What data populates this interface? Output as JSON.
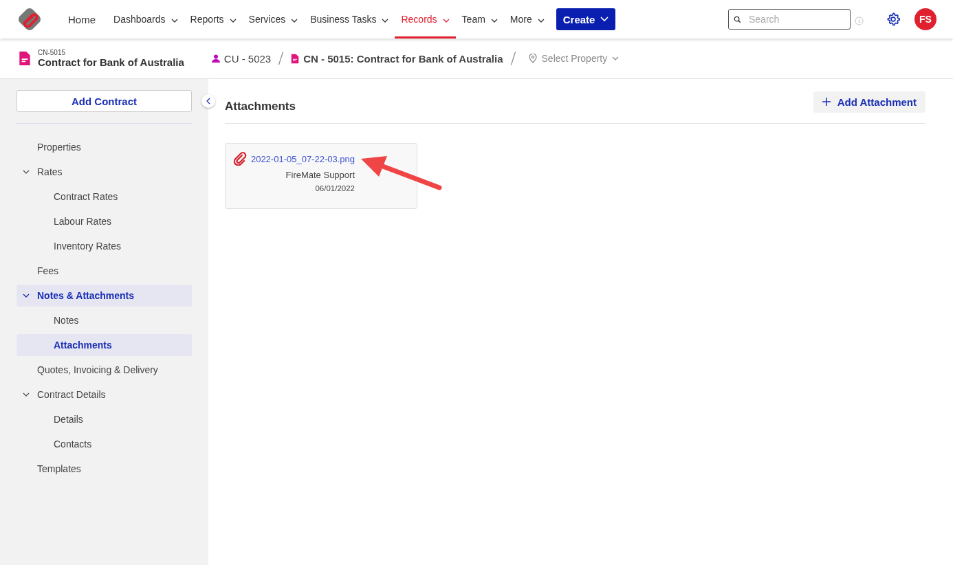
{
  "nav": {
    "items": [
      {
        "label": "Home",
        "dropdown": false,
        "selected": false
      },
      {
        "label": "Dashboards",
        "dropdown": true,
        "selected": false
      },
      {
        "label": "Reports",
        "dropdown": true,
        "selected": false
      },
      {
        "label": "Services",
        "dropdown": true,
        "selected": false
      },
      {
        "label": "Business Tasks",
        "dropdown": true,
        "selected": false
      },
      {
        "label": "Records",
        "dropdown": true,
        "selected": true
      },
      {
        "label": "Team",
        "dropdown": true,
        "selected": false
      },
      {
        "label": "More",
        "dropdown": true,
        "selected": false
      }
    ],
    "create_button": "Create",
    "search": {
      "placeholder": "Search"
    },
    "avatar": "FS"
  },
  "record": {
    "code": "CN-5015",
    "title": "Contract for Bank of Australia"
  },
  "breadcrumb": {
    "customer": "CU - 5023",
    "contract": "CN - 5015: Contract for Bank of Australia",
    "property": {
      "placeholder": "Select Property"
    }
  },
  "sidebar": {
    "button": "Add Contract",
    "items": [
      {
        "label": "Properties",
        "selected": false
      },
      {
        "label": "Rates",
        "selected": false,
        "expanded": true,
        "children": [
          {
            "label": "Contract Rates",
            "selected": false
          },
          {
            "label": "Labour Rates",
            "selected": false
          },
          {
            "label": "Inventory Rates",
            "selected": false
          }
        ]
      },
      {
        "label": "Fees",
        "selected": false
      },
      {
        "label": "Notes & Attachments",
        "selected": true,
        "expanded": true,
        "children": [
          {
            "label": "Notes",
            "selected": false
          },
          {
            "label": "Attachments",
            "selected": true
          }
        ]
      },
      {
        "label": "Quotes, Invoicing & Delivery",
        "selected": false
      },
      {
        "label": "Contract Details",
        "selected": false,
        "expanded": true,
        "children": [
          {
            "label": "Details",
            "selected": false
          },
          {
            "label": "Contacts",
            "selected": false
          }
        ]
      },
      {
        "label": "Templates",
        "selected": false
      }
    ]
  },
  "content": {
    "title": "Attachments",
    "add_button": "Add Attachment",
    "attachments": [
      {
        "file": "2022-01-05_07-22-03.png",
        "author": "FireMate Support",
        "date": "06/01/2022"
      }
    ]
  }
}
